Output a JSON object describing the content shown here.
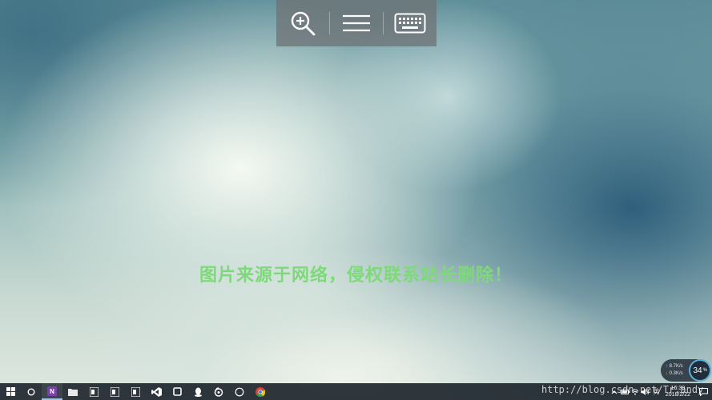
{
  "watermark": {
    "text": "图片来源于网络，侵权联系站长删除！",
    "url": "http://blog.csdn.net/Tr.andy"
  },
  "network": {
    "upload": "8.7K/s",
    "download": "0.3K/s",
    "usage": "34",
    "usage_unit": "%"
  },
  "clock": {
    "time": "16:30",
    "date": "2018/2/22"
  },
  "tray": {
    "language": "英"
  },
  "colors": {
    "watermark": "#7ed97a",
    "taskbar": "#1e262e",
    "toolbar": "#6e7376"
  }
}
